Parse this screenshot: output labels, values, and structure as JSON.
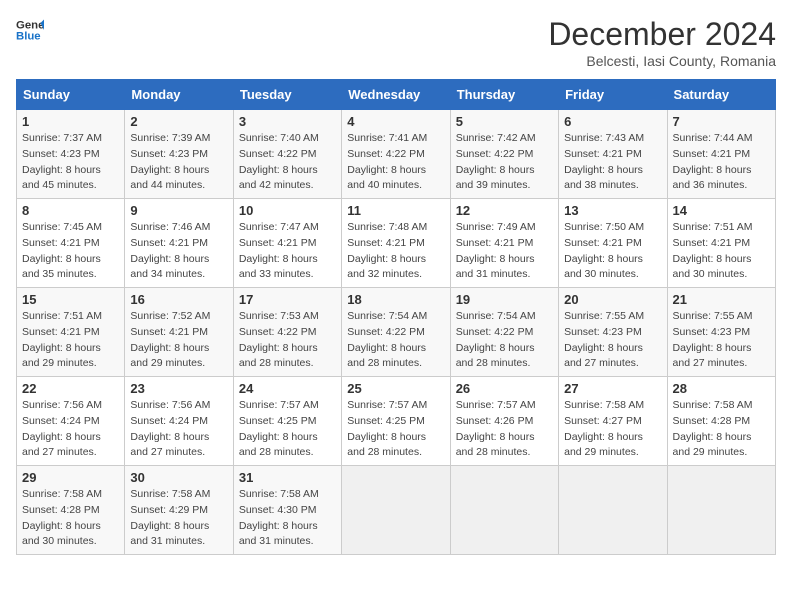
{
  "header": {
    "logo_line1": "General",
    "logo_line2": "Blue",
    "month": "December 2024",
    "location": "Belcesti, Iasi County, Romania"
  },
  "weekdays": [
    "Sunday",
    "Monday",
    "Tuesday",
    "Wednesday",
    "Thursday",
    "Friday",
    "Saturday"
  ],
  "weeks": [
    [
      {
        "day": "1",
        "sunrise": "7:37 AM",
        "sunset": "4:23 PM",
        "daylight": "8 hours and 45 minutes."
      },
      {
        "day": "2",
        "sunrise": "7:39 AM",
        "sunset": "4:23 PM",
        "daylight": "8 hours and 44 minutes."
      },
      {
        "day": "3",
        "sunrise": "7:40 AM",
        "sunset": "4:22 PM",
        "daylight": "8 hours and 42 minutes."
      },
      {
        "day": "4",
        "sunrise": "7:41 AM",
        "sunset": "4:22 PM",
        "daylight": "8 hours and 40 minutes."
      },
      {
        "day": "5",
        "sunrise": "7:42 AM",
        "sunset": "4:22 PM",
        "daylight": "8 hours and 39 minutes."
      },
      {
        "day": "6",
        "sunrise": "7:43 AM",
        "sunset": "4:21 PM",
        "daylight": "8 hours and 38 minutes."
      },
      {
        "day": "7",
        "sunrise": "7:44 AM",
        "sunset": "4:21 PM",
        "daylight": "8 hours and 36 minutes."
      }
    ],
    [
      {
        "day": "8",
        "sunrise": "7:45 AM",
        "sunset": "4:21 PM",
        "daylight": "8 hours and 35 minutes."
      },
      {
        "day": "9",
        "sunrise": "7:46 AM",
        "sunset": "4:21 PM",
        "daylight": "8 hours and 34 minutes."
      },
      {
        "day": "10",
        "sunrise": "7:47 AM",
        "sunset": "4:21 PM",
        "daylight": "8 hours and 33 minutes."
      },
      {
        "day": "11",
        "sunrise": "7:48 AM",
        "sunset": "4:21 PM",
        "daylight": "8 hours and 32 minutes."
      },
      {
        "day": "12",
        "sunrise": "7:49 AM",
        "sunset": "4:21 PM",
        "daylight": "8 hours and 31 minutes."
      },
      {
        "day": "13",
        "sunrise": "7:50 AM",
        "sunset": "4:21 PM",
        "daylight": "8 hours and 30 minutes."
      },
      {
        "day": "14",
        "sunrise": "7:51 AM",
        "sunset": "4:21 PM",
        "daylight": "8 hours and 30 minutes."
      }
    ],
    [
      {
        "day": "15",
        "sunrise": "7:51 AM",
        "sunset": "4:21 PM",
        "daylight": "8 hours and 29 minutes."
      },
      {
        "day": "16",
        "sunrise": "7:52 AM",
        "sunset": "4:21 PM",
        "daylight": "8 hours and 29 minutes."
      },
      {
        "day": "17",
        "sunrise": "7:53 AM",
        "sunset": "4:22 PM",
        "daylight": "8 hours and 28 minutes."
      },
      {
        "day": "18",
        "sunrise": "7:54 AM",
        "sunset": "4:22 PM",
        "daylight": "8 hours and 28 minutes."
      },
      {
        "day": "19",
        "sunrise": "7:54 AM",
        "sunset": "4:22 PM",
        "daylight": "8 hours and 28 minutes."
      },
      {
        "day": "20",
        "sunrise": "7:55 AM",
        "sunset": "4:23 PM",
        "daylight": "8 hours and 27 minutes."
      },
      {
        "day": "21",
        "sunrise": "7:55 AM",
        "sunset": "4:23 PM",
        "daylight": "8 hours and 27 minutes."
      }
    ],
    [
      {
        "day": "22",
        "sunrise": "7:56 AM",
        "sunset": "4:24 PM",
        "daylight": "8 hours and 27 minutes."
      },
      {
        "day": "23",
        "sunrise": "7:56 AM",
        "sunset": "4:24 PM",
        "daylight": "8 hours and 27 minutes."
      },
      {
        "day": "24",
        "sunrise": "7:57 AM",
        "sunset": "4:25 PM",
        "daylight": "8 hours and 28 minutes."
      },
      {
        "day": "25",
        "sunrise": "7:57 AM",
        "sunset": "4:25 PM",
        "daylight": "8 hours and 28 minutes."
      },
      {
        "day": "26",
        "sunrise": "7:57 AM",
        "sunset": "4:26 PM",
        "daylight": "8 hours and 28 minutes."
      },
      {
        "day": "27",
        "sunrise": "7:58 AM",
        "sunset": "4:27 PM",
        "daylight": "8 hours and 29 minutes."
      },
      {
        "day": "28",
        "sunrise": "7:58 AM",
        "sunset": "4:28 PM",
        "daylight": "8 hours and 29 minutes."
      }
    ],
    [
      {
        "day": "29",
        "sunrise": "7:58 AM",
        "sunset": "4:28 PM",
        "daylight": "8 hours and 30 minutes."
      },
      {
        "day": "30",
        "sunrise": "7:58 AM",
        "sunset": "4:29 PM",
        "daylight": "8 hours and 31 minutes."
      },
      {
        "day": "31",
        "sunrise": "7:58 AM",
        "sunset": "4:30 PM",
        "daylight": "8 hours and 31 minutes."
      },
      null,
      null,
      null,
      null
    ]
  ]
}
